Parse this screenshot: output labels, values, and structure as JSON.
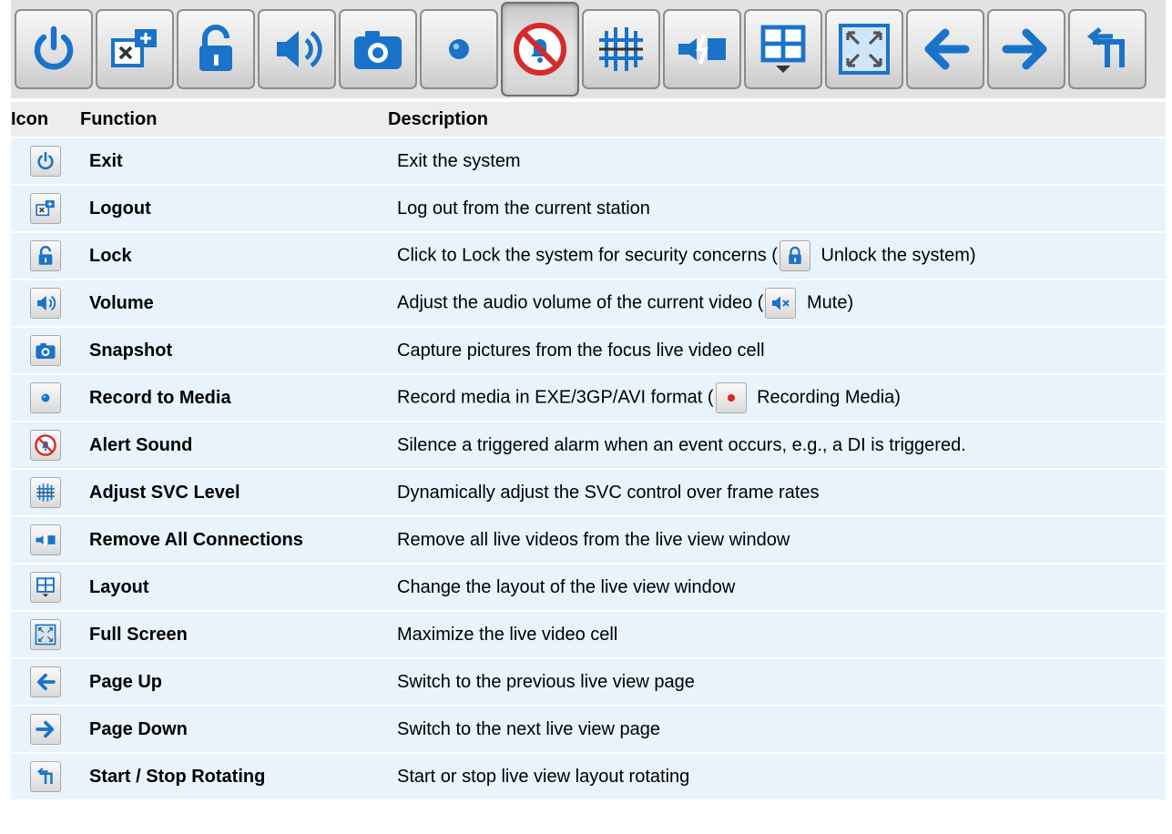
{
  "colors": {
    "blue": "#1a73c9",
    "red": "#d62a2a",
    "row_bg": "#e9f3fb",
    "header_bg": "#ededed"
  },
  "toolbar": {
    "buttons": [
      {
        "icon": "power-icon"
      },
      {
        "icon": "logout-icon"
      },
      {
        "icon": "lock-open-icon"
      },
      {
        "icon": "speaker-icon"
      },
      {
        "icon": "camera-icon"
      },
      {
        "icon": "record-dot-icon"
      },
      {
        "icon": "alert-sound-off-icon",
        "pressed": true
      },
      {
        "icon": "svc-level-icon"
      },
      {
        "icon": "disconnect-icon"
      },
      {
        "icon": "layout-grid-icon"
      },
      {
        "icon": "full-screen-icon"
      },
      {
        "icon": "arrow-left-icon"
      },
      {
        "icon": "arrow-right-icon"
      },
      {
        "icon": "rotate-icon"
      }
    ]
  },
  "table": {
    "headers": {
      "icon": "Icon",
      "function": "Function",
      "description": "Description"
    },
    "rows": [
      {
        "icon": "power-icon",
        "function": "Exit",
        "description": "Exit the system"
      },
      {
        "icon": "logout-icon",
        "function": "Logout",
        "description": "Log out from the current station"
      },
      {
        "icon": "lock-open-icon",
        "function": "Lock",
        "description": "Click to Lock the system for security concerns (",
        "inline_icon": "lock-closed-icon",
        "description_after": " Unlock the system)"
      },
      {
        "icon": "speaker-icon",
        "function": "Volume",
        "description": "Adjust the audio volume of the current video (",
        "inline_icon": "mute-icon",
        "description_after": " Mute)"
      },
      {
        "icon": "camera-icon",
        "function": "Snapshot",
        "description": "Capture pictures from the focus live video cell"
      },
      {
        "icon": "record-dot-icon",
        "function": "Record to Media",
        "description": "Record media in EXE/3GP/AVI format (",
        "inline_icon": "recording-dot-icon",
        "description_after": " Recording Media)"
      },
      {
        "icon": "alert-sound-off-icon",
        "function": "Alert Sound",
        "description": "Silence a triggered alarm when an event occurs, e.g., a DI is triggered."
      },
      {
        "icon": "svc-level-icon",
        "function": "Adjust SVC Level",
        "description": "Dynamically adjust the SVC control over frame rates"
      },
      {
        "icon": "disconnect-icon",
        "function": "Remove All Connections",
        "description": "Remove all live videos from the live view window"
      },
      {
        "icon": "layout-grid-icon",
        "function": "Layout",
        "description": "Change the layout of the live view window"
      },
      {
        "icon": "full-screen-icon",
        "function": "Full Screen",
        "description": "Maximize the live video cell"
      },
      {
        "icon": "arrow-left-icon",
        "function": "Page Up",
        "description": "Switch to the previous live view page"
      },
      {
        "icon": "arrow-right-icon",
        "function": "Page Down",
        "description": "Switch to the next live view page"
      },
      {
        "icon": "rotate-icon",
        "function": "Start / Stop Rotating",
        "description": "Start or stop live view layout rotating"
      }
    ]
  }
}
